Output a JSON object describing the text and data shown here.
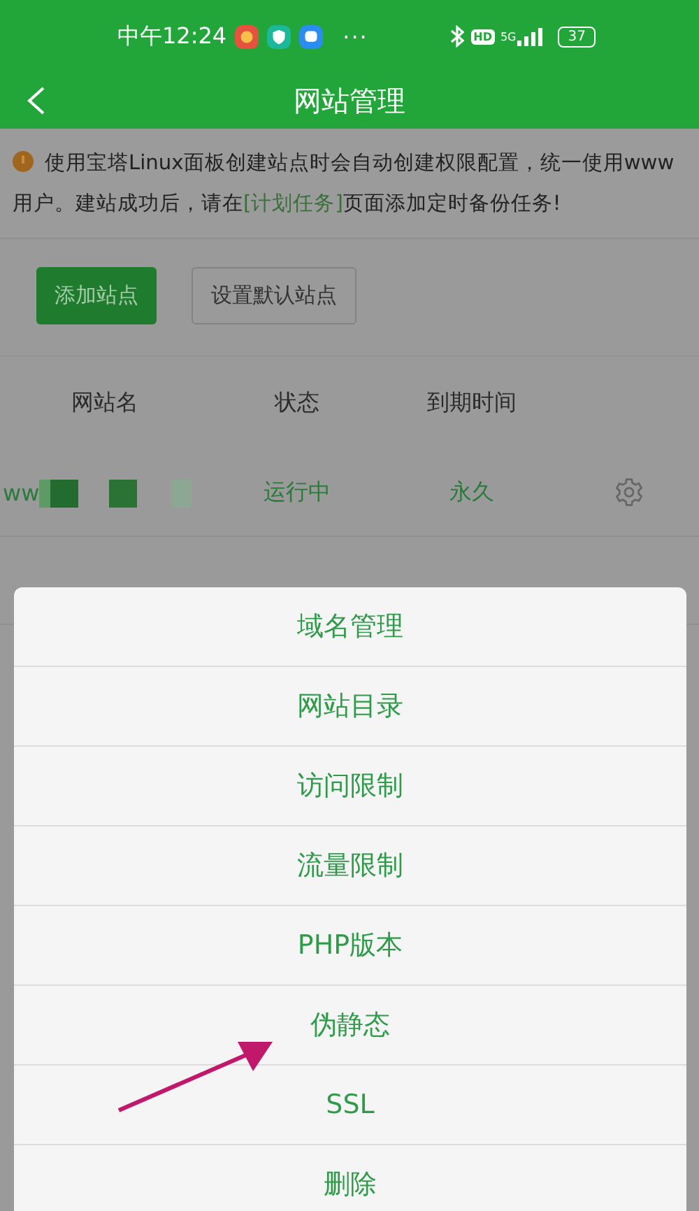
{
  "status_bar": {
    "time": "中午12:24",
    "more": "···",
    "hd": "HD",
    "network": "5G",
    "battery": "37"
  },
  "app_bar": {
    "title": "网站管理"
  },
  "notice": {
    "text": "使用宝塔Linux面板创建站点时会自动创建权限配置，统一使用www用户。建站成功后，请在",
    "link": "[计划任务]",
    "text_after": "页面添加定时备份任务!"
  },
  "buttons": [
    {
      "label": "添加站点",
      "kind": "primary"
    },
    {
      "label": "设置默认站点",
      "kind": "default"
    }
  ],
  "table": {
    "columns": [
      "网站名",
      "状态",
      "到期时间"
    ],
    "rows": [
      {
        "name": "ww",
        "status": "运行中",
        "color": "#2a7a3a",
        "expiry": "永久"
      }
    ]
  },
  "menu": {
    "items": [
      "域名管理",
      "网站目录",
      "访问限制",
      "流量限制",
      "PHP版本",
      "伪静态",
      "SSL",
      "删除"
    ]
  }
}
